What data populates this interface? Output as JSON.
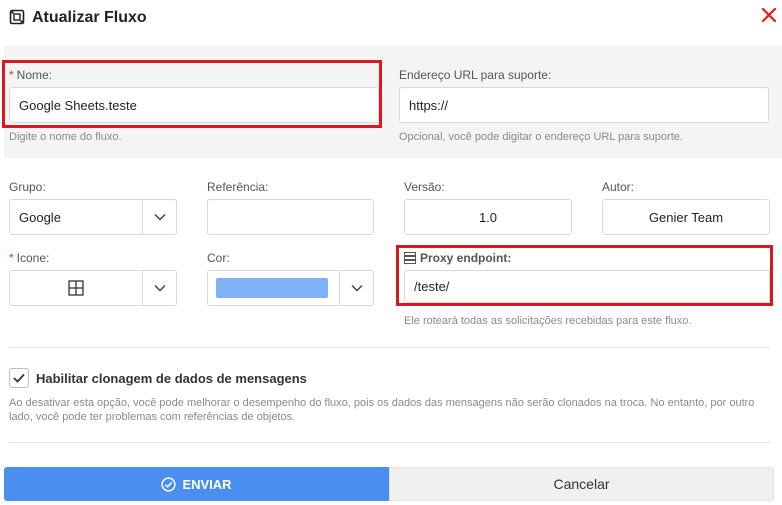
{
  "dialog": {
    "title": "Atualizar Fluxo",
    "icons": {
      "title_icon": "flow-icon",
      "close_icon": "close-icon"
    },
    "accent_color": "#d9181f"
  },
  "name_field": {
    "required_mark": "*",
    "label": "Nome:",
    "value": "Google Sheets.teste",
    "hint": "Digite o nome do fluxo."
  },
  "support_url_field": {
    "label": "Endereço URL para suporte:",
    "value": "https://",
    "hint": "Opcional, você pode digitar o endereço URL para suporte."
  },
  "group_field": {
    "label": "Grupo:",
    "value": "Google"
  },
  "reference_field": {
    "label": "Referência:",
    "value": ""
  },
  "version_field": {
    "label": "Versão:",
    "value": "1.0"
  },
  "author_field": {
    "label": "Autor:",
    "value": "Genier Team"
  },
  "icon_field": {
    "required_mark": "*",
    "label": "Icone:",
    "selected_icon": "grid-icon"
  },
  "color_field": {
    "label": "Cor:",
    "selected_color": "#7eb2f5"
  },
  "proxy_field": {
    "label": "Proxy endpoint:",
    "icon": "server-icon",
    "value": "/teste/",
    "hint": "Ele roteará todas as solicitações recebidas para este fluxo."
  },
  "cloning_option": {
    "checked": true,
    "label": "Habilitar clonagem de dados de mensagens",
    "description": "Ao desativar esta opção, você pode melhorar o desempenho do fluxo, pois os dados das mensagens não serão clonados na troca. No entanto, por outro lado, você pode ter problemas com referências de objetos."
  },
  "footer": {
    "submit_label": "ENVIAR",
    "submit_icon": "check-circle-icon",
    "submit_color": "#4a8ff0",
    "cancel_label": "Cancelar"
  }
}
